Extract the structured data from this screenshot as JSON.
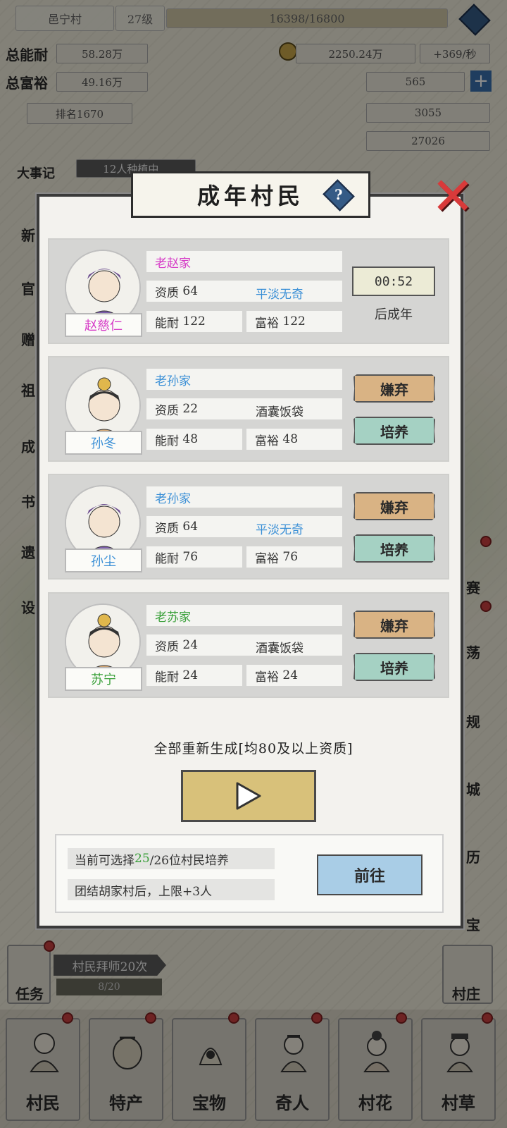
{
  "top": {
    "village_name": "邑宁村",
    "level": "27级",
    "exp": "16398/16800",
    "stat1_label": "总能耐",
    "stat1_value": "58.28万",
    "stat2_label": "总富裕",
    "stat2_value": "49.16万",
    "coins": "2250.24万",
    "coins_rate": "+369/秒",
    "resource2": "565",
    "rank": "排名1670",
    "resource3": "3055",
    "resource4": "27026",
    "chronicle": "大事记",
    "planting": "12人种植中..."
  },
  "modal": {
    "title": "成年村民",
    "help": "?",
    "villagers": [
      {
        "family": "老赵家",
        "name": "赵慈仁",
        "name_color": "#d63cc7",
        "family_color": "#d63cc7",
        "quality_label": "资质",
        "quality": "64",
        "tag": "平淡无奇",
        "tag_color": "#3a8fd6",
        "endurance_label": "能耐",
        "endurance": "122",
        "wealth_label": "富裕",
        "wealth": "122",
        "timer": "00:52",
        "timer_sub": "后成年"
      },
      {
        "family": "老孙家",
        "name": "孙冬",
        "name_color": "#3a8fd6",
        "family_color": "#3a8fd6",
        "quality_label": "资质",
        "quality": "22",
        "tag": "酒囊饭袋",
        "tag_color": "#333333",
        "endurance_label": "能耐",
        "endurance": "48",
        "wealth_label": "富裕",
        "wealth": "48",
        "discard": "嫌弃",
        "train": "培养"
      },
      {
        "family": "老孙家",
        "name": "孙尘",
        "name_color": "#3a8fd6",
        "family_color": "#3a8fd6",
        "quality_label": "资质",
        "quality": "64",
        "tag": "平淡无奇",
        "tag_color": "#3a8fd6",
        "endurance_label": "能耐",
        "endurance": "76",
        "wealth_label": "富裕",
        "wealth": "76",
        "discard": "嫌弃",
        "train": "培养"
      },
      {
        "family": "老苏家",
        "name": "苏宁",
        "name_color": "#3aa03a",
        "family_color": "#3aa03a",
        "quality_label": "资质",
        "quality": "24",
        "tag": "酒囊饭袋",
        "tag_color": "#333333",
        "endurance_label": "能耐",
        "endurance": "24",
        "wealth_label": "富裕",
        "wealth": "24",
        "discard": "嫌弃",
        "train": "培养"
      }
    ],
    "regen_text": "全部重新生成[均80及以上资质]",
    "info_prefix": "当前可选择",
    "info_count": "25",
    "info_suffix": "/26位村民培养",
    "info_line2": "团结胡家村后，上限+3人",
    "goto": "前往"
  },
  "side_left": [
    "新",
    "官",
    "赠",
    "祖",
    "成",
    "书",
    "遗",
    "设"
  ],
  "side_right": [
    "赛",
    "荡",
    "规",
    "城",
    "历",
    "宝"
  ],
  "task": {
    "label": "任务",
    "banner": "村民拜师20次",
    "progress": "8/20"
  },
  "village_btn": "村庄",
  "nav": [
    {
      "label": "村民",
      "icon": "villager-icon"
    },
    {
      "label": "特产",
      "icon": "specialty-icon"
    },
    {
      "label": "宝物",
      "icon": "treasure-icon"
    },
    {
      "label": "奇人",
      "icon": "stranger-icon"
    },
    {
      "label": "村花",
      "icon": "village-belle-icon"
    },
    {
      "label": "村草",
      "icon": "village-beau-icon"
    }
  ],
  "colors": {
    "accent_blue": "#3a8fd6",
    "discard": "#d9b384",
    "train": "#a5d1c3",
    "goto": "#a9cde6",
    "play": "#d8c17a",
    "close": "#d93a3a"
  }
}
